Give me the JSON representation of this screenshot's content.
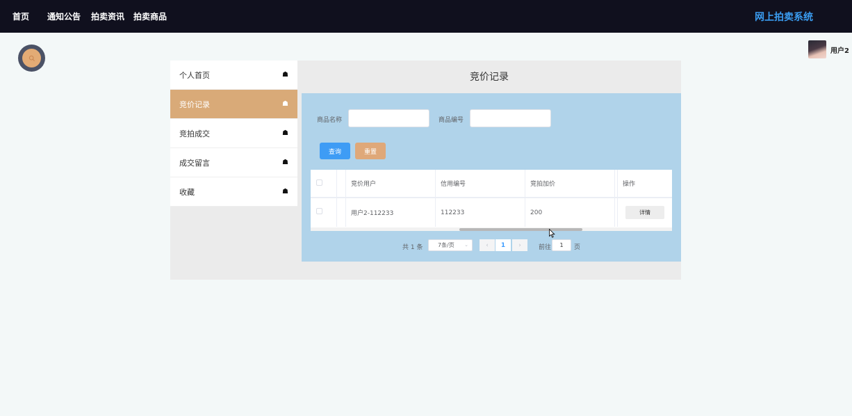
{
  "nav": {
    "items": [
      {
        "label": "首页"
      },
      {
        "label": "通知公告"
      },
      {
        "label": "拍卖资讯"
      },
      {
        "label": "拍卖商品"
      }
    ],
    "brand": "网上拍卖系统"
  },
  "user": {
    "name": "用户2"
  },
  "sidebar": {
    "items": [
      {
        "label": "个人首页",
        "active": false
      },
      {
        "label": "竞价记录",
        "active": true
      },
      {
        "label": "竞拍成交",
        "active": false
      },
      {
        "label": "成交留言",
        "active": false
      },
      {
        "label": "收藏",
        "active": false
      }
    ],
    "item_icon": "home-icon"
  },
  "page_title": "竞价记录",
  "search": {
    "name_label": "商品名称",
    "name_value": "",
    "code_label": "商品编号",
    "code_value": "",
    "query_label": "查询",
    "reset_label": "重置"
  },
  "table": {
    "columns": [
      "竞价用户",
      "信用编号",
      "竞拍加价",
      "操作"
    ],
    "rows": [
      {
        "user": "用户2-112233",
        "credit": "112233",
        "price": "200",
        "action": "详情"
      }
    ]
  },
  "pagination": {
    "total": "共 1 条",
    "page_size": "7条/页",
    "current": "1",
    "goto_label": "前往",
    "goto_value": "1",
    "page_unit": "页"
  },
  "colors": {
    "topbar": "#10101e",
    "brand": "#3a9cf0",
    "accent": "#d9aa78",
    "content_bg": "#b0d3ea",
    "primary": "#3e9cf5"
  }
}
